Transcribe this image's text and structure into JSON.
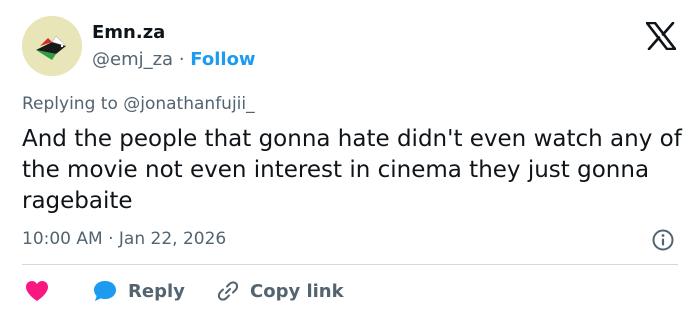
{
  "author": {
    "display_name": "Emn.za",
    "handle": "@emj_za",
    "separator": "·",
    "follow_label": "Follow",
    "avatar_icon": "palestine-flag-bird-icon"
  },
  "brand": {
    "logo": "x-logo-icon"
  },
  "tweet": {
    "replying_to": "Replying to @jonathanfujii_",
    "text": "And the people that gonna hate didn't even watch any of the movie not even interest in cinema they just gonna ragebaite",
    "timestamp": "10:00 AM · Jan 22, 2026"
  },
  "actions": {
    "like_icon": "heart-icon",
    "reply_label": "Reply",
    "reply_icon": "speech-bubble-icon",
    "copy_label": "Copy link",
    "copy_icon": "link-icon",
    "info_icon": "info-icon"
  },
  "colors": {
    "text": "#0f1419",
    "muted": "#536471",
    "accent": "#1d9bf0",
    "like": "#f91880",
    "divider": "#cfd9de"
  }
}
